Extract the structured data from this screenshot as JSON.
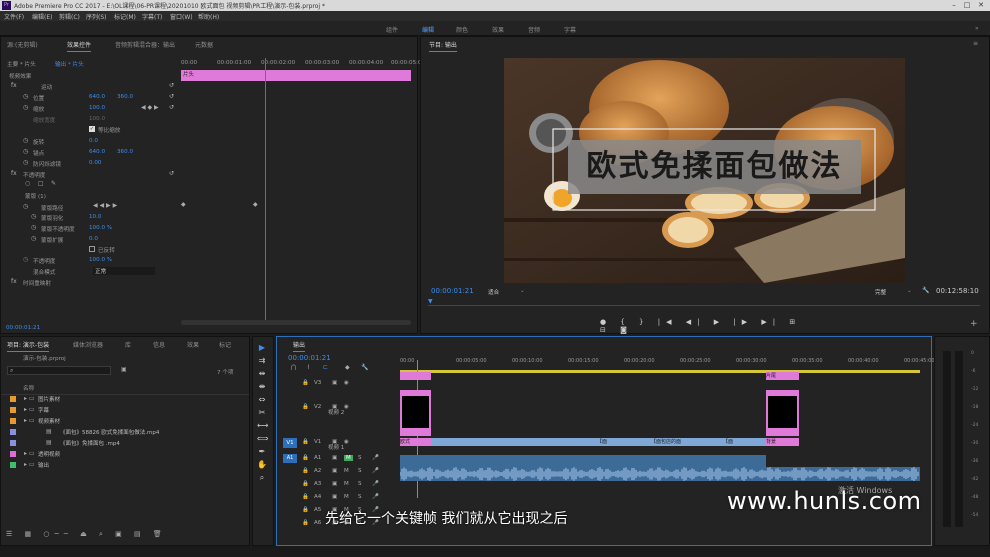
{
  "window": {
    "title": "Adobe Premiere Pro CC 2017 - E:\\OL课程\\06-PR课程\\20201010 欧式面包 视频剪辑\\PR工程\\演示-包装.prproj *"
  },
  "menu": [
    "文件(F)",
    "编辑(E)",
    "剪辑(C)",
    "序列(S)",
    "标记(M)",
    "字幕(T)",
    "窗口(W)",
    "帮助(H)"
  ],
  "workspaces": [
    "组件",
    "编辑",
    "颜色",
    "效果",
    "音频",
    "字幕"
  ],
  "source_panel": {
    "tabs": [
      "源:(无剪辑)",
      "效果控件",
      "音频剪辑混合器：输出",
      "元数据"
    ],
    "master_label": "主要 * 片头",
    "clip_label": "输出 * 片头",
    "section_video": "视频效果",
    "timecodes": [
      "00:00",
      "00:00:01:00",
      "00:00:02:00",
      "00:00:03:00",
      "00:00:04:00",
      "00:00:05:00"
    ],
    "clip_name": "片头",
    "motion": "运动",
    "props": [
      {
        "name": "位置",
        "v1": "640.0",
        "v2": "360.0"
      },
      {
        "name": "缩放",
        "v1": "100.0",
        "v2": ""
      },
      {
        "name": "缩放宽度",
        "v1": "100.0",
        "v2": ""
      },
      {
        "name": "等比缩放",
        "v1": "",
        "v2": ""
      },
      {
        "name": "旋转",
        "v1": "0.0",
        "v2": ""
      },
      {
        "name": "锚点",
        "v1": "640.0",
        "v2": "360.0"
      },
      {
        "name": "防闪烁滤镜",
        "v1": "0.00",
        "v2": ""
      }
    ],
    "opacity": "不透明度",
    "mask": "蒙版 (1)",
    "mask_props": [
      {
        "name": "蒙版路径",
        "v": ""
      },
      {
        "name": "蒙版羽化",
        "v": "10.0"
      },
      {
        "name": "蒙版不透明度",
        "v": "100.0 %"
      },
      {
        "name": "蒙版扩展",
        "v": "0.0"
      },
      {
        "name": "已反转",
        "v": ""
      }
    ],
    "opacity_row": {
      "name": "不透明度",
      "v": "100.0 %"
    },
    "blend_row": {
      "name": "混合模式",
      "v": "正常"
    },
    "time_remap": "时间重映射",
    "timecode": "00:00:01:21"
  },
  "program": {
    "tab": "节目: 输出",
    "title_overlay": "欧式免揉面包做法",
    "timecode_left": "00:00:01:21",
    "fit": "适合",
    "quality": "完整",
    "timecode_right": "00:12:58:10"
  },
  "project": {
    "tabs": [
      "项目: 演示-包装",
      "媒体浏览器",
      "库",
      "信息",
      "效果",
      "标记"
    ],
    "file": "演示-包装.prproj",
    "count": "7 个项",
    "col_name": "名称",
    "items": [
      {
        "name": "图片素材",
        "color": "#e89a2c",
        "indent": 0
      },
      {
        "name": "字幕",
        "color": "#e89a2c",
        "indent": 0
      },
      {
        "name": "视频素材",
        "color": "#e89a2c",
        "indent": 0
      },
      {
        "name": "《面包》58826 欧式免揉面包做法.mp4",
        "color": "#8890e0",
        "indent": 1
      },
      {
        "name": "《面包》免揉面包 .mp4",
        "color": "#8890e0",
        "indent": 1
      },
      {
        "name": "透明视频",
        "color": "#e06ad8",
        "indent": 0
      },
      {
        "name": "输出",
        "color": "#3fbf6a",
        "indent": 0
      }
    ]
  },
  "timeline": {
    "tab": "输出",
    "timecode": "00:00:01:21",
    "ruler": [
      "00:00",
      "00:00:05:00",
      "00:00:10:00",
      "00:00:15:00",
      "00:00:20:00",
      "00:00:25:00",
      "00:00:30:00",
      "00:00:35:00",
      "00:00:40:00",
      "00:00:45:00"
    ],
    "video_tracks": [
      "V3",
      "V2",
      "V1"
    ],
    "audio_tracks": [
      "A1",
      "A2",
      "A3",
      "A4",
      "A5",
      "A6"
    ],
    "v2_name": "视频 2",
    "v1_name": "视频 1",
    "clip_v3_end": "片尾",
    "clip_v1_start": "欧式",
    "clip_v1_mid1": "【面",
    "clip_v1_mid2": "【面包店的面",
    "clip_v1_mid3": "【面",
    "clip_v1_end": "【面",
    "clip_v1_last": "背景"
  },
  "subtitle": "先给它一个关键帧 我们就从它出现之后",
  "watermark": "www.hunls.com",
  "activation": "激活 Windows",
  "meter_ticks": [
    "0",
    "-6",
    "-12",
    "-18",
    "-24",
    "-30",
    "-36",
    "-42",
    "-48",
    "-54"
  ]
}
